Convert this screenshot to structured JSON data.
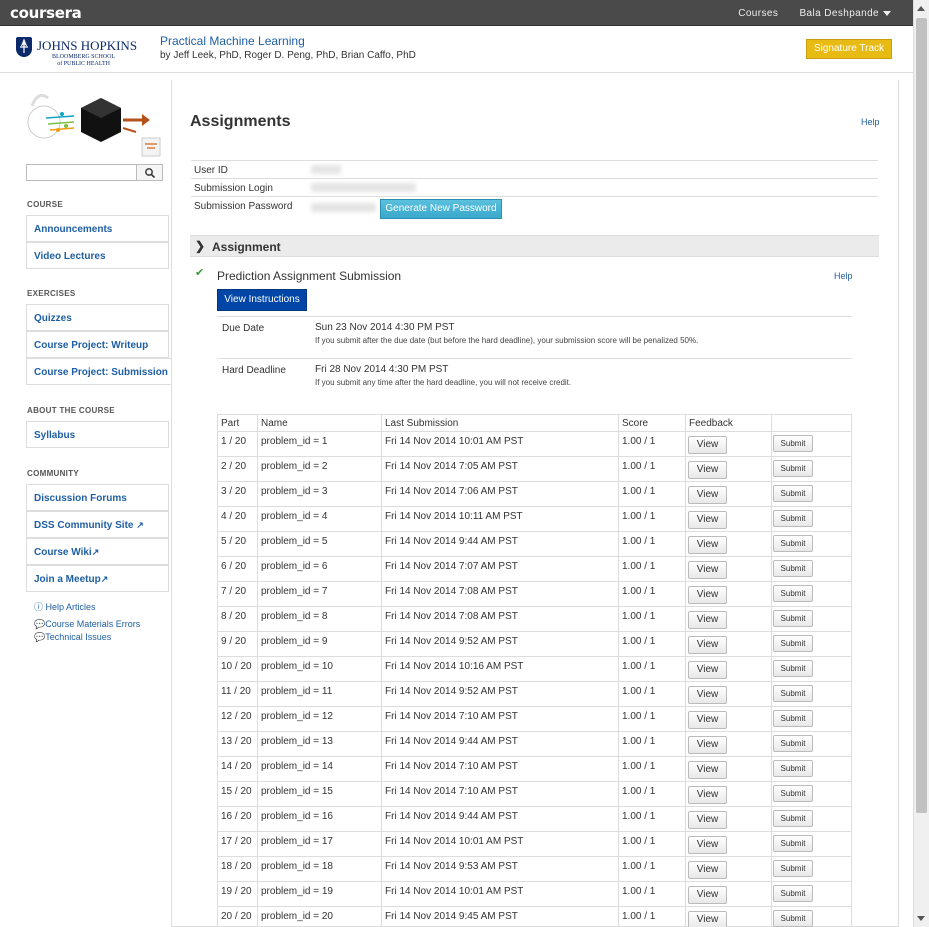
{
  "topbar": {
    "logo": "coursera",
    "courses_label": "Courses",
    "user_label": "Bala Deshpande"
  },
  "header": {
    "org_name": "JOHNS HOPKINS",
    "org_sub_1": "BLOOMBERG SCHOOL",
    "org_sub_2": "of PUBLIC HEALTH",
    "course_title": "Practical Machine Learning",
    "course_authors": "by Jeff Leek, PhD, Roger D. Peng, PhD, Brian Caffo, PhD",
    "signature_track_label": "Signature Track"
  },
  "sidebar": {
    "course_heading": "COURSE",
    "course_items": [
      "Announcements",
      "Video Lectures"
    ],
    "exercises_heading": "EXERCISES",
    "exercise_items": [
      "Quizzes",
      "Course Project: Writeup",
      "Course Project: Submission"
    ],
    "about_heading": "ABOUT THE COURSE",
    "about_items": [
      "Syllabus"
    ],
    "community_heading": "COMMUNITY",
    "community_items": [
      "Discussion Forums",
      "DSS Community Site",
      "Course Wiki",
      "Join a Meetup"
    ],
    "help_links": [
      "Help Articles",
      "Course Materials Errors",
      "Technical Issues"
    ]
  },
  "main": {
    "page_title": "Assignments",
    "help_label": "Help",
    "user_id_label": "User ID",
    "submission_login_label": "Submission Login",
    "submission_password_label": "Submission Password",
    "generate_password_label": "Generate New Password",
    "assignment_label": "Assignment",
    "submission_title": "Prediction Assignment Submission",
    "view_instructions_label": "View Instructions",
    "due_date_label": "Due Date",
    "due_date_value": "Sun 23 Nov 2014 4:30 PM PST",
    "due_date_note": "If you submit after the due date (but before the hard deadline), your submission score will be penalized 50%.",
    "hard_deadline_label": "Hard Deadline",
    "hard_deadline_value": "Fri 28 Nov 2014 4:30 PM PST",
    "hard_deadline_note": "If you submit any time after the hard deadline, you will not receive credit."
  },
  "table": {
    "headers": [
      "Part",
      "Name",
      "Last Submission",
      "Score",
      "Feedback",
      ""
    ],
    "view_label": "View",
    "submit_label": "Submit",
    "rows": [
      {
        "part": "1 / 20",
        "name": "problem_id = 1",
        "last": "Fri 14 Nov 2014 10:01 AM PST",
        "score": "1.00 / 1"
      },
      {
        "part": "2 / 20",
        "name": "problem_id = 2",
        "last": "Fri 14 Nov 2014 7:05 AM PST",
        "score": "1.00 / 1"
      },
      {
        "part": "3 / 20",
        "name": "problem_id = 3",
        "last": "Fri 14 Nov 2014 7:06 AM PST",
        "score": "1.00 / 1"
      },
      {
        "part": "4 / 20",
        "name": "problem_id = 4",
        "last": "Fri 14 Nov 2014 10:11 AM PST",
        "score": "1.00 / 1"
      },
      {
        "part": "5 / 20",
        "name": "problem_id = 5",
        "last": "Fri 14 Nov 2014 9:44 AM PST",
        "score": "1.00 / 1"
      },
      {
        "part": "6 / 20",
        "name": "problem_id = 6",
        "last": "Fri 14 Nov 2014 7:07 AM PST",
        "score": "1.00 / 1"
      },
      {
        "part": "7 / 20",
        "name": "problem_id = 7",
        "last": "Fri 14 Nov 2014 7:08 AM PST",
        "score": "1.00 / 1"
      },
      {
        "part": "8 / 20",
        "name": "problem_id = 8",
        "last": "Fri 14 Nov 2014 7:08 AM PST",
        "score": "1.00 / 1"
      },
      {
        "part": "9 / 20",
        "name": "problem_id = 9",
        "last": "Fri 14 Nov 2014 9:52 AM PST",
        "score": "1.00 / 1"
      },
      {
        "part": "10 / 20",
        "name": "problem_id = 10",
        "last": "Fri 14 Nov 2014 10:16 AM PST",
        "score": "1.00 / 1"
      },
      {
        "part": "11 / 20",
        "name": "problem_id = 11",
        "last": "Fri 14 Nov 2014 9:52 AM PST",
        "score": "1.00 / 1"
      },
      {
        "part": "12 / 20",
        "name": "problem_id = 12",
        "last": "Fri 14 Nov 2014 7:10 AM PST",
        "score": "1.00 / 1"
      },
      {
        "part": "13 / 20",
        "name": "problem_id = 13",
        "last": "Fri 14 Nov 2014 9:44 AM PST",
        "score": "1.00 / 1"
      },
      {
        "part": "14 / 20",
        "name": "problem_id = 14",
        "last": "Fri 14 Nov 2014 7:10 AM PST",
        "score": "1.00 / 1"
      },
      {
        "part": "15 / 20",
        "name": "problem_id = 15",
        "last": "Fri 14 Nov 2014 7:10 AM PST",
        "score": "1.00 / 1"
      },
      {
        "part": "16 / 20",
        "name": "problem_id = 16",
        "last": "Fri 14 Nov 2014 9:44 AM PST",
        "score": "1.00 / 1"
      },
      {
        "part": "17 / 20",
        "name": "problem_id = 17",
        "last": "Fri 14 Nov 2014 10:01 AM PST",
        "score": "1.00 / 1"
      },
      {
        "part": "18 / 20",
        "name": "problem_id = 18",
        "last": "Fri 14 Nov 2014 9:53 AM PST",
        "score": "1.00 / 1"
      },
      {
        "part": "19 / 20",
        "name": "problem_id = 19",
        "last": "Fri 14 Nov 2014 10:01 AM PST",
        "score": "1.00 / 1"
      },
      {
        "part": "20 / 20",
        "name": "problem_id = 20",
        "last": "Fri 14 Nov 2014 9:45 AM PST",
        "score": "1.00 / 1"
      }
    ]
  },
  "colors": {
    "topbar": "#4a4a4a",
    "link": "#1f5fa3",
    "signature_track": "#e8bb14",
    "primary_button": "#0046a6",
    "info_button": "#5bc0de",
    "check": "#3a9a3a"
  }
}
